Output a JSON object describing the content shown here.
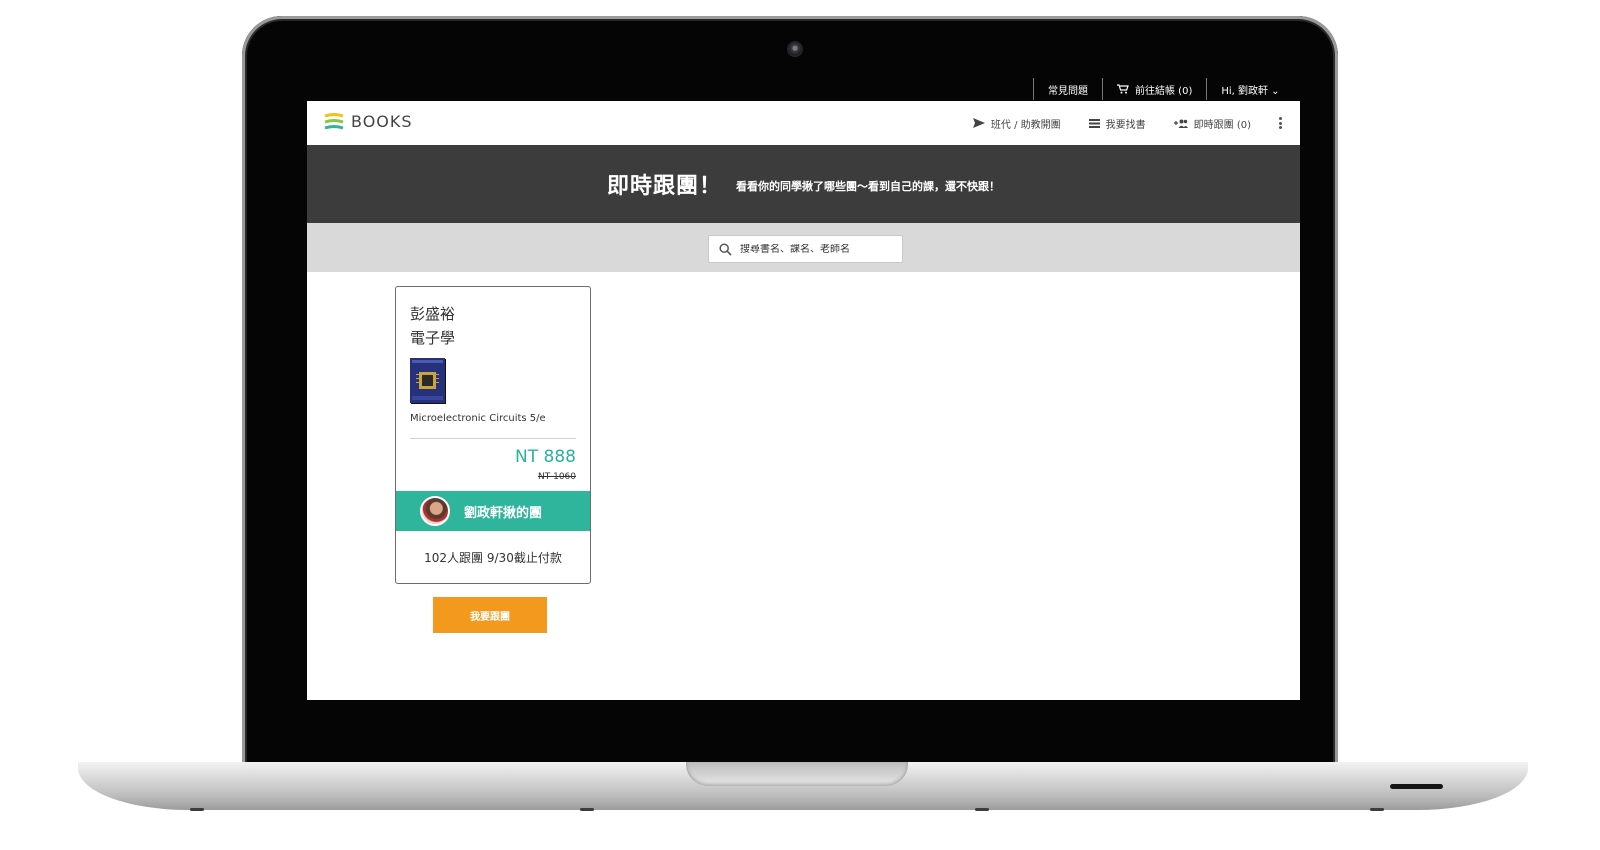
{
  "util_bar": {
    "faq": "常見問題",
    "checkout": "前往結帳 (0)",
    "user": "Hi, 劉政軒 ⌄"
  },
  "navbar": {
    "logo_text": "BOOKS",
    "items": [
      {
        "label": "班代 / 助教開團",
        "icon": "send-icon"
      },
      {
        "label": "我要找書",
        "icon": "list-icon"
      },
      {
        "label": "即時跟團 (0)",
        "icon": "group-add-icon"
      }
    ],
    "menu_icon": "more-vert-icon"
  },
  "hero": {
    "title": "即時跟團！",
    "subtitle": "看看你的同學揪了哪些團～看到自己的課，還不快跟！"
  },
  "search": {
    "placeholder": "搜尋書名、課名、老師名"
  },
  "group_cards": [
    {
      "teacher": "彭盛裕",
      "course": "電子學",
      "book_title": "Microelectronic Circuits 5/e",
      "price": "NT 888",
      "original_price": "NT 1060",
      "owner_label": "劉政軒揪的團",
      "status": "102人跟團 9/30截止付款",
      "join_label": "我要跟團"
    }
  ],
  "colors": {
    "accent_teal": "#2fb59b",
    "join_orange": "#f39a1e",
    "hero_bg": "#3c3c3c",
    "search_band": "#d9d9d9"
  }
}
